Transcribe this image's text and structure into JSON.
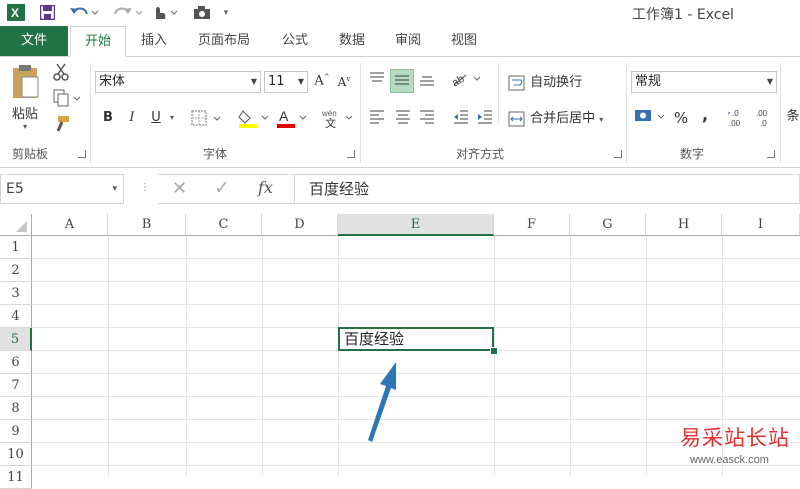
{
  "window": {
    "title": "工作簿1 - Excel"
  },
  "tabs": [
    {
      "label": "文件"
    },
    {
      "label": "开始"
    },
    {
      "label": "插入"
    },
    {
      "label": "页面布局"
    },
    {
      "label": "公式"
    },
    {
      "label": "数据"
    },
    {
      "label": "审阅"
    },
    {
      "label": "视图"
    }
  ],
  "ribbon": {
    "clipboard": {
      "paste_label": "粘贴",
      "group_label": "剪贴板"
    },
    "font": {
      "font_name": "宋体",
      "font_size": "11",
      "bold": "B",
      "italic": "I",
      "underline": "U",
      "group_label": "字体"
    },
    "alignment": {
      "wrap_text": "自动换行",
      "merge_center": "合并后居中",
      "group_label": "对齐方式"
    },
    "number": {
      "format": "常规",
      "percent": "%",
      "comma": ",",
      "group_label": "数字"
    },
    "styles": {
      "cut_label": "条"
    }
  },
  "formula_bar": {
    "name_box": "E5",
    "fx": "fx",
    "value": "百度经验"
  },
  "sheet": {
    "columns": [
      "A",
      "B",
      "C",
      "D",
      "E",
      "F",
      "G",
      "H",
      "I"
    ],
    "rows": [
      "1",
      "2",
      "3",
      "4",
      "5",
      "6",
      "7",
      "8",
      "9",
      "10",
      "11"
    ],
    "active_cell": "E5",
    "cell_E5": "百度经验"
  },
  "watermark": {
    "text": "易采站长站",
    "url": "www.easck.com"
  },
  "colors": {
    "accent": "#217346",
    "arrow": "#2e75b6"
  }
}
